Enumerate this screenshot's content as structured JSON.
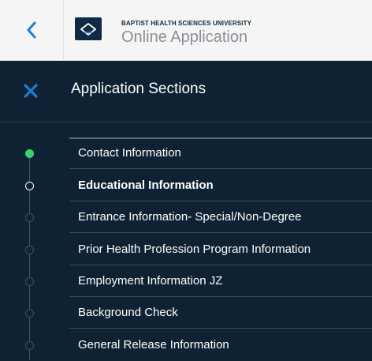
{
  "header": {
    "org_name": "BAPTIST HEALTH SCIENCES UNIVERSITY",
    "app_title": "Online Application",
    "back_icon": "chevron-left-icon",
    "logo_icon": "university-logo"
  },
  "sections_bar": {
    "title": "Application Sections",
    "close_icon": "close-icon"
  },
  "sections": [
    {
      "label": "Contact Information",
      "status": "done"
    },
    {
      "label": "Educational Information",
      "status": "current"
    },
    {
      "label": "Entrance Information- Special/Non-Degree",
      "status": "pending"
    },
    {
      "label": "Prior Health Profession Program Information",
      "status": "pending"
    },
    {
      "label": "Employment Information JZ",
      "status": "pending"
    },
    {
      "label": "Background Check",
      "status": "pending"
    },
    {
      "label": "General Release Information",
      "status": "pending"
    }
  ],
  "colors": {
    "background": "#0f2233",
    "accent": "#1a7fd4",
    "done": "#39d36a"
  }
}
